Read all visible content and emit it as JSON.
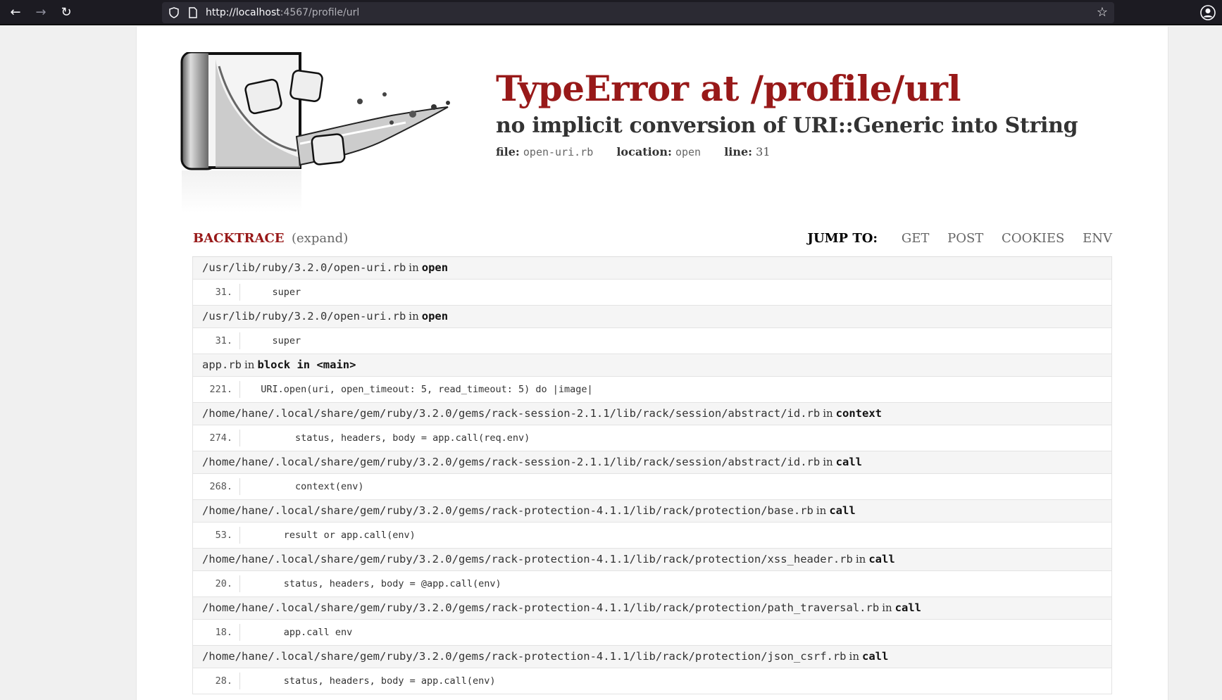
{
  "browser": {
    "url_host": "http://localhost",
    "url_rest": ":4567/profile/url"
  },
  "error": {
    "title": "TypeError at /profile/url",
    "message": "no implicit conversion of URI::Generic into String",
    "file_label": "file:",
    "file_value": "open-uri.rb",
    "location_label": "location:",
    "location_value": "open",
    "line_label": "line:",
    "line_value": "31"
  },
  "backtrace": {
    "title": "BACKTRACE",
    "expand": "(expand)",
    "jump_label": "JUMP TO:",
    "jump_links": [
      "GET",
      "POST",
      "COOKIES",
      "ENV"
    ],
    "in_word": "in",
    "frames": [
      {
        "file": "/usr/lib/ruby/3.2.0/open-uri.rb",
        "function": "open",
        "line": "31.",
        "code": "    super"
      },
      {
        "file": "/usr/lib/ruby/3.2.0/open-uri.rb",
        "function": "open",
        "line": "31.",
        "code": "    super"
      },
      {
        "file": "app.rb",
        "function": "block in <main>",
        "line": "221.",
        "code": "  URI.open(uri, open_timeout: 5, read_timeout: 5) do |image|"
      },
      {
        "file": "/home/hane/.local/share/gem/ruby/3.2.0/gems/rack-session-2.1.1/lib/rack/session/abstract/id.rb",
        "function": "context",
        "line": "274.",
        "code": "        status, headers, body = app.call(req.env)"
      },
      {
        "file": "/home/hane/.local/share/gem/ruby/3.2.0/gems/rack-session-2.1.1/lib/rack/session/abstract/id.rb",
        "function": "call",
        "line": "268.",
        "code": "        context(env)"
      },
      {
        "file": "/home/hane/.local/share/gem/ruby/3.2.0/gems/rack-protection-4.1.1/lib/rack/protection/base.rb",
        "function": "call",
        "line": "53.",
        "code": "      result or app.call(env)"
      },
      {
        "file": "/home/hane/.local/share/gem/ruby/3.2.0/gems/rack-protection-4.1.1/lib/rack/protection/xss_header.rb",
        "function": "call",
        "line": "20.",
        "code": "      status, headers, body = @app.call(env)"
      },
      {
        "file": "/home/hane/.local/share/gem/ruby/3.2.0/gems/rack-protection-4.1.1/lib/rack/protection/path_traversal.rb",
        "function": "call",
        "line": "18.",
        "code": "      app.call env"
      },
      {
        "file": "/home/hane/.local/share/gem/ruby/3.2.0/gems/rack-protection-4.1.1/lib/rack/protection/json_csrf.rb",
        "function": "call",
        "line": "28.",
        "code": "      status, headers, body = app.call(env)"
      }
    ]
  }
}
